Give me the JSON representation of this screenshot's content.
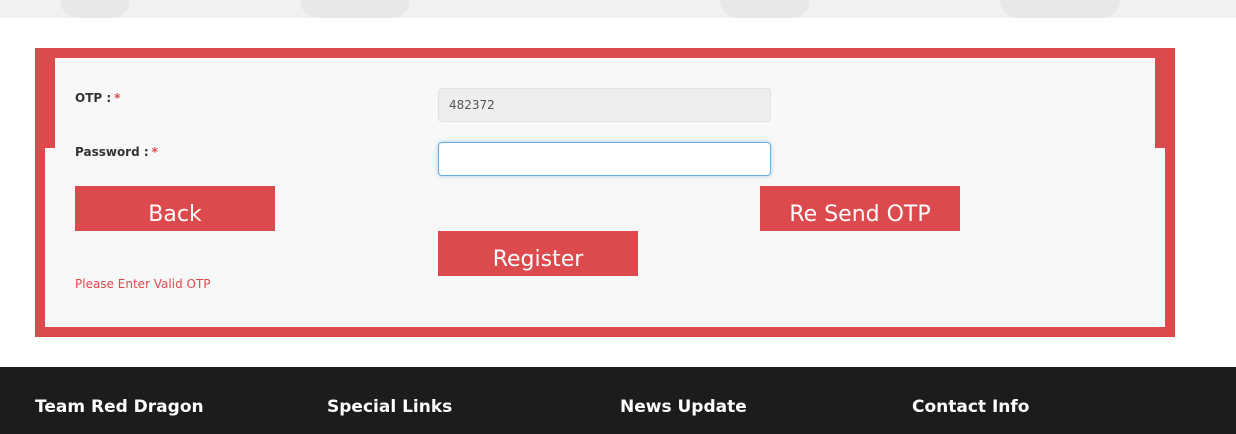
{
  "form": {
    "otp_label": "OTP :",
    "otp_required": "*",
    "otp_value": "482372",
    "password_label": "Password :",
    "password_required": "*",
    "password_value": "",
    "back_button": "Back",
    "resend_button": "Re Send OTP",
    "register_button": "Register",
    "error_message": "Please Enter Valid OTP"
  },
  "footer": {
    "headings": [
      "Team Red Dragon",
      "Special Links",
      "News Update",
      "Contact Info"
    ]
  },
  "colors": {
    "accent": "#dc4a4d",
    "footer_bg": "#1c1c1c",
    "form_bg": "#f8f8f8"
  }
}
